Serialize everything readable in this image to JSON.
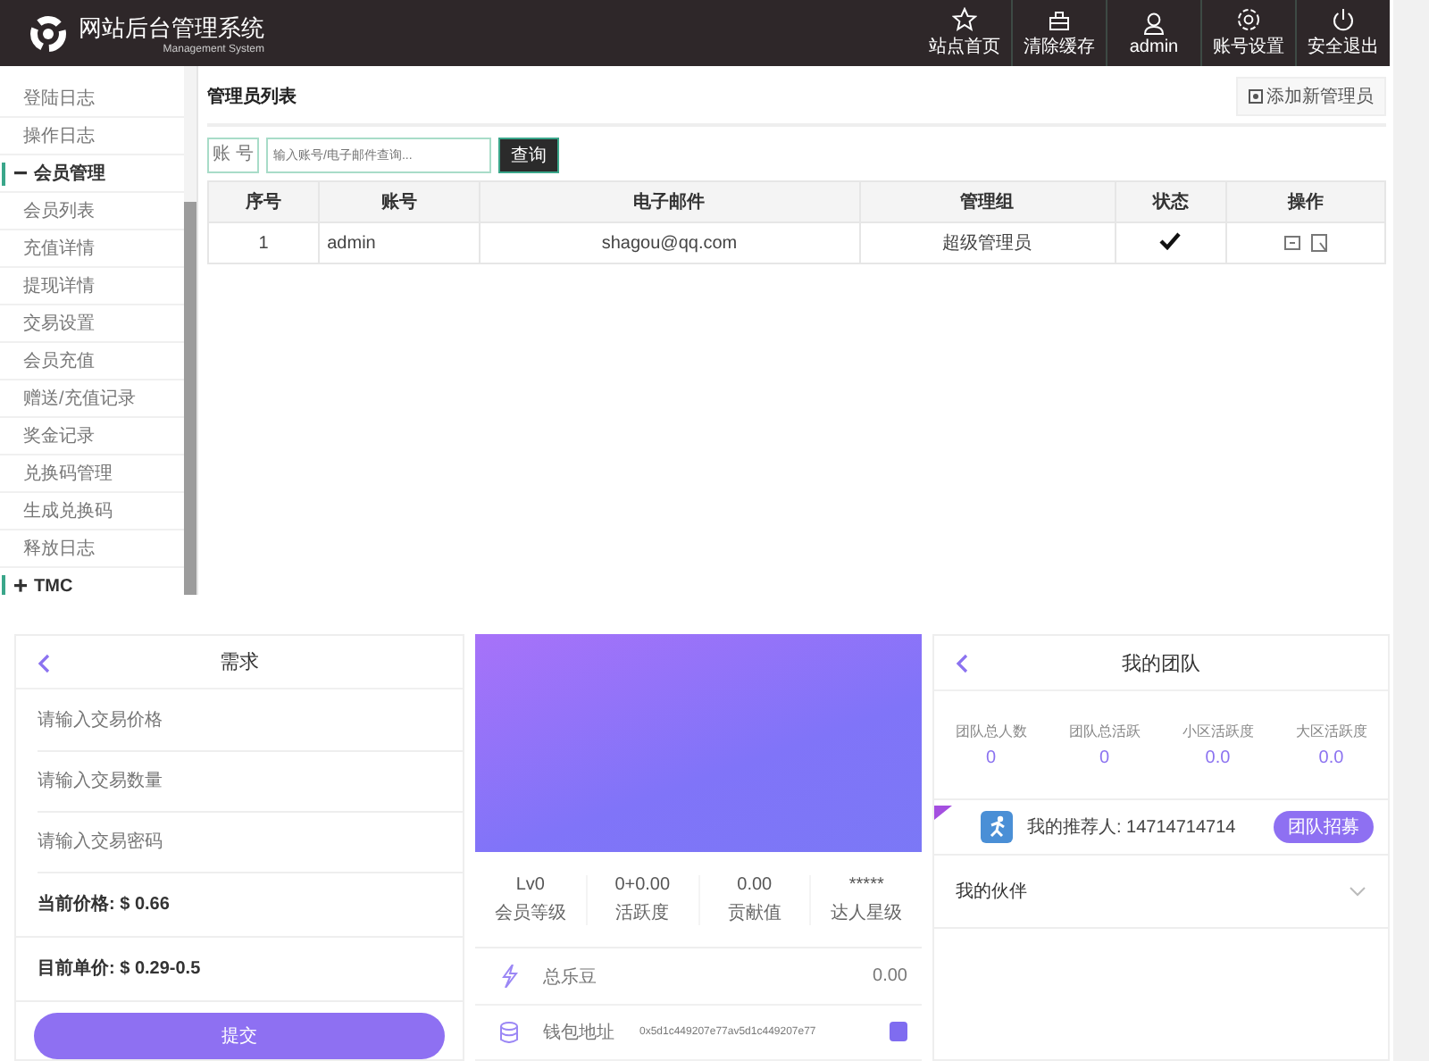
{
  "header": {
    "title": "网站后台管理系统",
    "subtitle": "Management System",
    "nav": [
      {
        "label": "站点首页"
      },
      {
        "label": "清除缓存"
      },
      {
        "label": "admin"
      },
      {
        "label": "账号设置"
      },
      {
        "label": "安全退出"
      }
    ]
  },
  "sidebar": {
    "items": [
      {
        "label": "登陆日志"
      },
      {
        "label": "操作日志"
      },
      {
        "label": "会员管理",
        "expanded": true,
        "children": [
          {
            "label": "会员列表"
          },
          {
            "label": "充值详情"
          },
          {
            "label": "提现详情"
          },
          {
            "label": "交易设置"
          },
          {
            "label": "会员充值"
          },
          {
            "label": "赠送/充值记录"
          },
          {
            "label": "奖金记录"
          },
          {
            "label": "兑换码管理"
          },
          {
            "label": "生成兑换码"
          },
          {
            "label": "释放日志"
          }
        ]
      },
      {
        "label": "TMC",
        "expanded": false
      }
    ]
  },
  "admin_list": {
    "title": "管理员列表",
    "add_button": "添加新管理员",
    "search": {
      "label": "账 号",
      "placeholder": "输入账号/电子邮件查询...",
      "button": "查询"
    },
    "table": {
      "columns": [
        "序号",
        "账号",
        "电子邮件",
        "管理组",
        "状态",
        "操作"
      ],
      "rows": [
        {
          "index": "1",
          "account": "admin",
          "email": "shagou@qq.com",
          "group": "超级管理员",
          "active": true
        }
      ]
    }
  },
  "demand": {
    "title": "需求",
    "fields": [
      {
        "placeholder": "请输入交易价格"
      },
      {
        "placeholder": "请输入交易数量"
      },
      {
        "placeholder": "请输入交易密码"
      }
    ],
    "current_price": "当前价格: $ 0.66",
    "unit_price": "目前单价: $ 0.29-0.5",
    "submit": "提交"
  },
  "profile": {
    "stats": [
      {
        "value": "Lv0",
        "label": "会员等级"
      },
      {
        "value": "0+0.00",
        "label": "活跃度"
      },
      {
        "value": "0.00",
        "label": "贡献值"
      },
      {
        "value": "*****",
        "label": "达人星级"
      }
    ],
    "rows": [
      {
        "kind": "balance",
        "label": "总乐豆",
        "value": "0.00"
      },
      {
        "kind": "wallet",
        "label": "钱包地址",
        "value": "0x5d1c449207e77av5d1c449207e77"
      }
    ]
  },
  "team": {
    "title": "我的团队",
    "stats": [
      {
        "label": "团队总人数",
        "value": "0"
      },
      {
        "label": "团队总活跃",
        "value": "0"
      },
      {
        "label": "小区活跃度",
        "value": "0.0"
      },
      {
        "label": "大区活跃度",
        "value": "0.0"
      }
    ],
    "referrer": "我的推荐人: 14714714714",
    "recruit_button": "团队招募",
    "partners": {
      "label": "我的伙伴",
      "expanded": false
    }
  }
}
